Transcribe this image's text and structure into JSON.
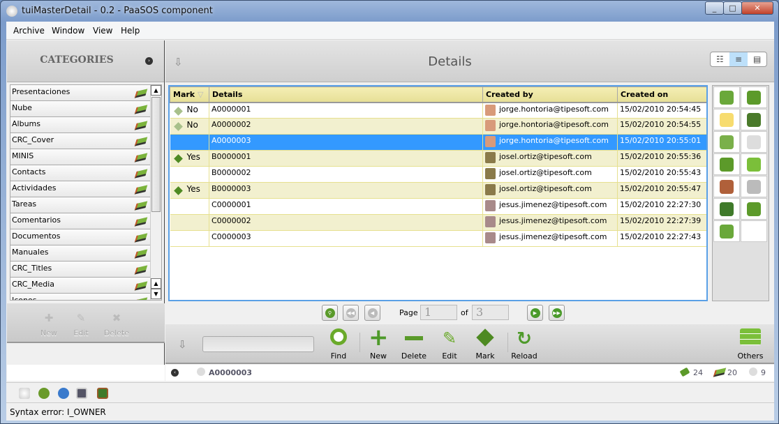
{
  "window": {
    "title": "tuiMasterDetail - 0.2 - PaaSOS component",
    "controls": [
      "minimize",
      "maximize",
      "close"
    ]
  },
  "menu": [
    "Archive",
    "Window",
    "View",
    "Help"
  ],
  "categories": {
    "title": "CATEGORIES",
    "items": [
      "Presentaciones",
      "Nube",
      "Albums",
      "CRC_Cover",
      "MINIS",
      "Contacts",
      "Actividades",
      "Tareas",
      "Comentarios",
      "Documentos",
      "Manuales",
      "CRC_Titles",
      "CRC_Media",
      "Iconos"
    ],
    "toolbar": {
      "new": "New",
      "edit": "Edit",
      "delete": "Delete"
    }
  },
  "details": {
    "title": "Details",
    "columns": [
      "Mark",
      "Details",
      "Created by",
      "Created on"
    ],
    "rows": [
      {
        "mark": "No",
        "marked": false,
        "details": "A0000001",
        "created_by": "jorge.hontoria@tipesoft.com",
        "created_on": "15/02/2010 20:54:45"
      },
      {
        "mark": "No",
        "marked": false,
        "details": "A0000002",
        "created_by": "jorge.hontoria@tipesoft.com",
        "created_on": "15/02/2010 20:54:55"
      },
      {
        "mark": "",
        "marked": null,
        "details": "A0000003",
        "created_by": "jorge.hontoria@tipesoft.com",
        "created_on": "15/02/2010 20:55:01",
        "selected": true
      },
      {
        "mark": "Yes",
        "marked": true,
        "details": "B0000001",
        "created_by": "josel.ortiz@tipesoft.com",
        "created_on": "15/02/2010 20:55:36"
      },
      {
        "mark": "",
        "marked": null,
        "details": "B0000002",
        "created_by": "josel.ortiz@tipesoft.com",
        "created_on": "15/02/2010 20:55:43"
      },
      {
        "mark": "Yes",
        "marked": true,
        "details": "B0000003",
        "created_by": "josel.ortiz@tipesoft.com",
        "created_on": "15/02/2010 20:55:47"
      },
      {
        "mark": "",
        "marked": null,
        "details": "C0000001",
        "created_by": "jesus.jimenez@tipesoft.com",
        "created_on": "15/02/2010 22:27:30"
      },
      {
        "mark": "",
        "marked": null,
        "details": "C0000002",
        "created_by": "jesus.jimenez@tipesoft.com",
        "created_on": "15/02/2010 22:27:39"
      },
      {
        "mark": "",
        "marked": null,
        "details": "C0000003",
        "created_by": "jesus.jimenez@tipesoft.com",
        "created_on": "15/02/2010 22:27:43"
      }
    ],
    "pager": {
      "page_label": "Page",
      "page": "1",
      "of_label": "of",
      "total": "3"
    },
    "toolbar": {
      "find": "Find",
      "new": "New",
      "delete": "Delete",
      "edit": "Edit",
      "mark": "Mark",
      "reload": "Reload",
      "others": "Others",
      "search_value": ""
    },
    "status": {
      "current": "A0000003",
      "count_tags": "24",
      "count_books": "20",
      "count_items": "9"
    }
  },
  "side_icons": [
    "book-icon",
    "tag-icon",
    "note-icon",
    "chalkboard-icon",
    "picture-icon",
    "paperclip-icon",
    "home-icon",
    "rss-icon",
    "clipboard-icon",
    "phone-icon",
    "font-book-icon",
    "clock-icon",
    "contacts-book-icon"
  ],
  "statusbar": {
    "message": "Syntax error: I_OWNER"
  }
}
